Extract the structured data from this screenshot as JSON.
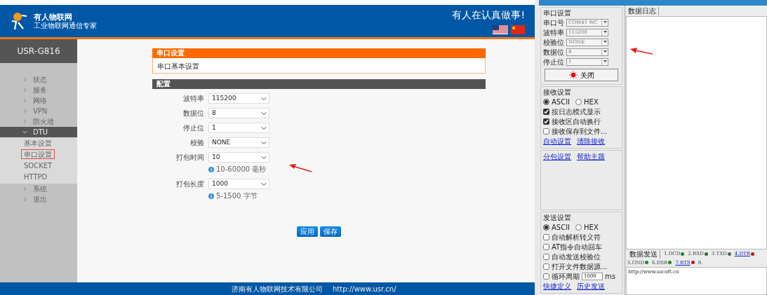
{
  "header": {
    "brand": "有人物联网",
    "tagline": "工业物联网通信专家",
    "slogan": "有人在认真做事!"
  },
  "sidebar": {
    "device": "USR-G816",
    "items": [
      {
        "label": "状态",
        "expanded": false
      },
      {
        "label": "服务",
        "expanded": false
      },
      {
        "label": "网络",
        "expanded": false
      },
      {
        "label": "VPN",
        "expanded": false
      },
      {
        "label": "防火墙",
        "expanded": false
      },
      {
        "label": "DTU",
        "expanded": true,
        "children": [
          {
            "label": "基本设置",
            "selected": false
          },
          {
            "label": "串口设置",
            "selected": true
          },
          {
            "label": "SOCKET",
            "selected": false
          },
          {
            "label": "HTTPD",
            "selected": false
          }
        ]
      },
      {
        "label": "系统",
        "expanded": false
      },
      {
        "label": "退出",
        "expanded": false
      }
    ]
  },
  "panel": {
    "title": "串口设置",
    "subtitle": "串口基本设置"
  },
  "config": {
    "title": "配置",
    "fields": [
      {
        "label": "波特率",
        "value": "115200"
      },
      {
        "label": "数据位",
        "value": "8"
      },
      {
        "label": "停止位",
        "value": "1"
      },
      {
        "label": "校验",
        "value": "NONE"
      },
      {
        "label": "打包时间",
        "value": "10",
        "hint": "10-60000 毫秒"
      },
      {
        "label": "打包长度",
        "value": "1000",
        "hint": "5-1500 字节"
      }
    ]
  },
  "buttons": [
    "应用",
    "保存"
  ],
  "footer": {
    "company": "济南有人物联网技术有限公司",
    "url": "http://www.usr.cn/"
  },
  "serial_tool": {
    "port_group": {
      "title": "串口设置",
      "fields": [
        {
          "label": "串口号",
          "value": "COM41 WC"
        },
        {
          "label": "波特率",
          "value": "115200"
        },
        {
          "label": "校验位",
          "value": "NONE"
        },
        {
          "label": "数据位",
          "value": "8"
        },
        {
          "label": "停止位",
          "value": "1"
        }
      ],
      "open_button": "关闭"
    },
    "receive_group": {
      "title": "接收设置",
      "modes": [
        {
          "label": "ASCII",
          "selected": true
        },
        {
          "label": "HEX",
          "selected": false
        }
      ],
      "options": [
        {
          "label": "按日志模式显示",
          "checked": true
        },
        {
          "label": "接收区自动换行",
          "checked": true
        },
        {
          "label": "接收保存到文件...",
          "checked": false
        }
      ],
      "links": [
        "自动设置",
        "清除接收"
      ]
    },
    "extra_links": [
      "分包设置",
      "帮助主题"
    ],
    "send_group": {
      "title": "发送设置",
      "modes": [
        {
          "label": "ASCII",
          "selected": true
        },
        {
          "label": "HEX",
          "selected": false
        }
      ],
      "options": [
        {
          "label": "自动解析转义符",
          "checked": false
        },
        {
          "label": "AT指令自动回车",
          "checked": false
        },
        {
          "label": "自动发送校验位",
          "checked": false
        },
        {
          "label": "打开文件数据源...",
          "checked": false
        }
      ],
      "loop": {
        "label": "循环周期",
        "checked": false,
        "value": "1000",
        "unit": "ms"
      },
      "links": [
        "快捷定义",
        "历史发送"
      ]
    },
    "log_tab": "数据日志",
    "send_tab": "数据发送",
    "signals": [
      {
        "label": "1.DCD",
        "kind": "plain",
        "color": "#1e8a2a"
      },
      {
        "label": "2.RXD",
        "kind": "plain",
        "color": "#2f6b3a"
      },
      {
        "label": "3.TXD",
        "kind": "plain",
        "color": "#4b6b50"
      },
      {
        "label": "4.DTR",
        "kind": "link",
        "color": "#c0141c"
      },
      {
        "label": "5.GND",
        "kind": "plain",
        "color": "#1e8a2a"
      },
      {
        "label": "6.DSR",
        "kind": "plain",
        "color": "#1e8a2a"
      },
      {
        "label": "7.RTS",
        "kind": "link",
        "color": "#c0141c"
      },
      {
        "label": "8.",
        "kind": "plain"
      }
    ],
    "send_text": "http://www.sscoft.cn"
  }
}
